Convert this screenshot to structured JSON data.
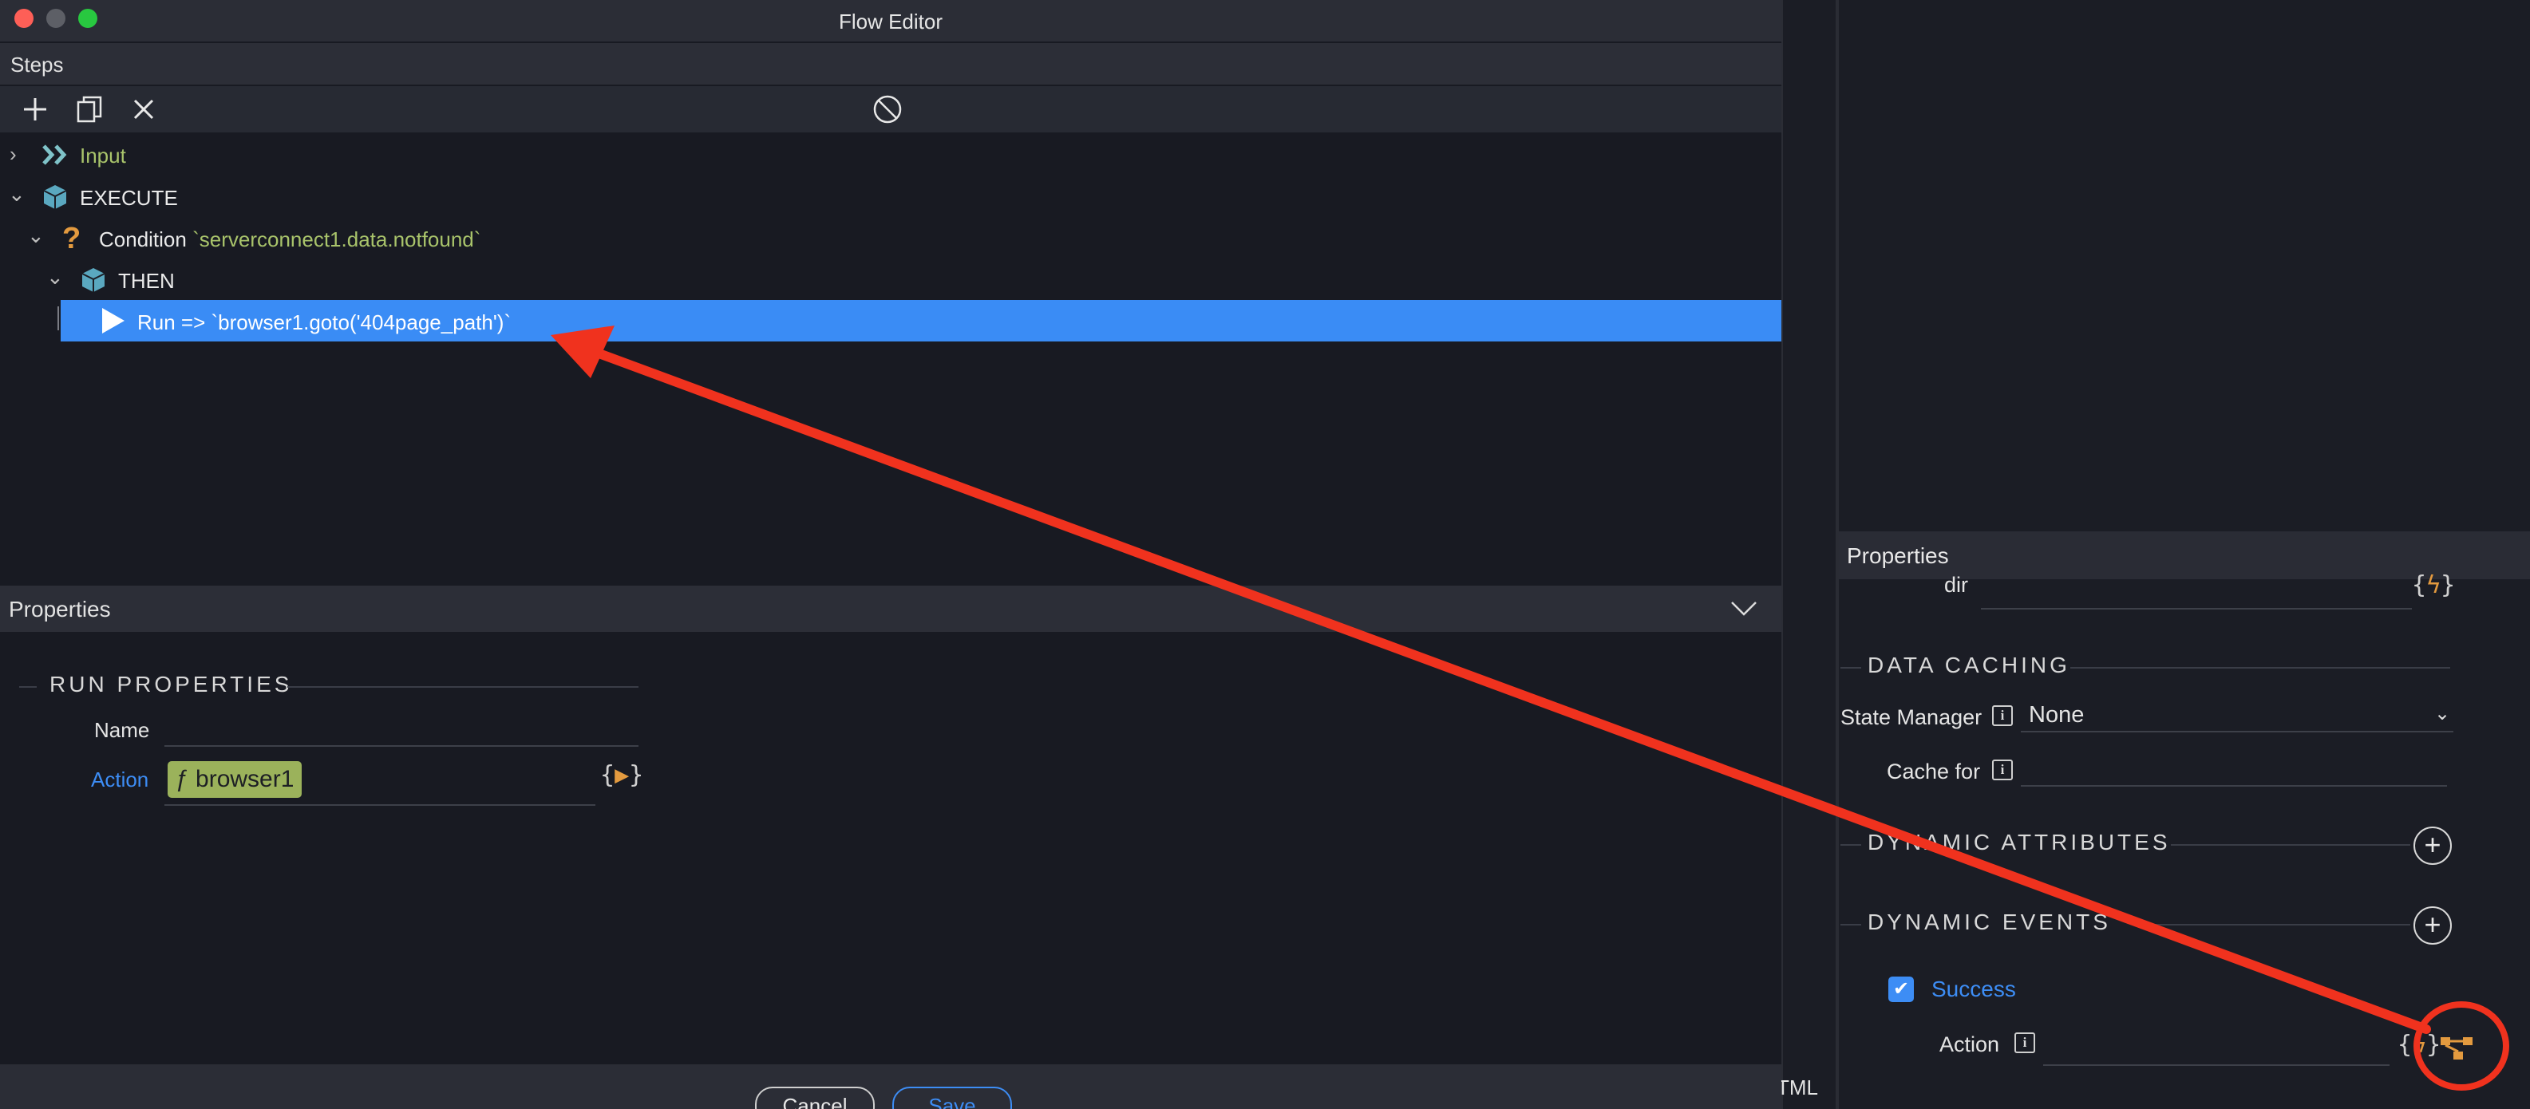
{
  "window": {
    "title": "Flow Editor",
    "traffic_colors": [
      "#fe5f57",
      "#5d5f66",
      "#28c840"
    ]
  },
  "steps": {
    "header": "Steps",
    "toolbar": {
      "add_icon": "plus-icon",
      "copy_icon": "copy-icon",
      "delete_icon": "close-icon",
      "disable_icon": "disable-icon"
    },
    "tree": {
      "input": {
        "label": "Input"
      },
      "execute": {
        "label": "EXECUTE"
      },
      "condition": {
        "label": "Condition",
        "expression": "`serverconnect1.data.notfound`"
      },
      "then": {
        "label": "THEN"
      },
      "run": {
        "label": "Run => `browser1.goto('404page_path')`"
      }
    }
  },
  "properties": {
    "header": "Properties",
    "section": "RUN PROPERTIES",
    "name_label": "Name",
    "name_value": "",
    "action_label": "Action",
    "action_value": "browser1",
    "action_prefix": "ƒ"
  },
  "footer": {
    "cancel": "Cancel",
    "save": "Save"
  },
  "right_panel": {
    "header": "Properties",
    "dir_label": "dir",
    "data_caching": "DATA CACHING",
    "state_manager_label": "State Manager",
    "state_manager_value": "None",
    "cache_for_label": "Cache for",
    "dynamic_attributes": "DYNAMIC ATTRIBUTES",
    "dynamic_events": "DYNAMIC EVENTS",
    "success_label": "Success",
    "success_checked": true,
    "action_label": "Action",
    "stray_text": "TML"
  },
  "accent_colors": {
    "selection": "#3a8cf5",
    "arrow": "#f0321e",
    "link_blue": "#3d8df5",
    "pill_green": "#9bb25b",
    "flow_orange": "#e39a3f"
  }
}
